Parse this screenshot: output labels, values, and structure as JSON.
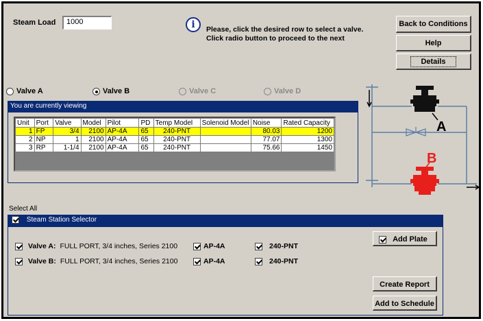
{
  "header": {
    "steam_load_label": "Steam Load",
    "steam_load_value": "1000",
    "info_line1": "Please, click the desired row to select a valve.",
    "info_line2": "Click radio button to proceed to the next"
  },
  "buttons": {
    "back": "Back to Conditions",
    "help": "Help",
    "details": "Details",
    "add_plate": "Add Plate",
    "create_report": "Create Report",
    "add_to_schedule": "Add to Schedule"
  },
  "valves": [
    {
      "label": "Valve A",
      "selected": false,
      "enabled": true
    },
    {
      "label": "Valve B",
      "selected": true,
      "enabled": true
    },
    {
      "label": "Valve C",
      "selected": false,
      "enabled": false
    },
    {
      "label": "Valve D",
      "selected": false,
      "enabled": false
    }
  ],
  "viewing_bar": "You are currently viewing",
  "table": {
    "columns": [
      "Unit",
      "Port",
      "Valve",
      "Model",
      "Pilot",
      "PD",
      "Temp Model",
      "Solenoid Model",
      "Noise",
      "Rated Capacity"
    ],
    "rows": [
      [
        "1",
        "FP",
        "3/4",
        "2100",
        "AP-4A",
        "65",
        "240-PNT",
        "",
        "80.03",
        "1200"
      ],
      [
        "2",
        "NP",
        "1",
        "2100",
        "AP-4A",
        "65",
        "240-PNT",
        "",
        "77.07",
        "1300"
      ],
      [
        "3",
        "RP",
        "1-1/4",
        "2100",
        "AP-4A",
        "65",
        "240-PNT",
        "",
        "75.66",
        "1450"
      ]
    ]
  },
  "diagram": {
    "label_a": "A",
    "label_b": "B"
  },
  "select_all": "Select All",
  "selector_title": "Steam Station Selector",
  "selections": [
    {
      "valve_label": "Valve A:",
      "desc": "FULL PORT, 3/4 inches, Series 2100",
      "pilot": "AP-4A",
      "temp": "240-PNT"
    },
    {
      "valve_label": "Valve B:",
      "desc": "FULL PORT, 3/4 inches, Series 2100",
      "pilot": "AP-4A",
      "temp": "240-PNT"
    }
  ],
  "colors": {
    "selected_row": "#ffff00",
    "titlebar": "#0a2a74",
    "valve_b": "#e8201c"
  }
}
